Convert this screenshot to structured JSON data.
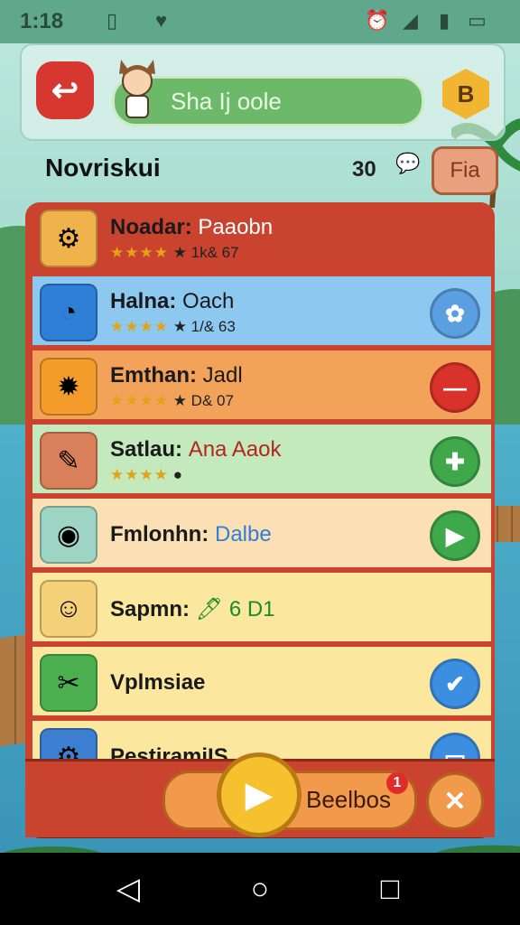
{
  "status_bar": {
    "time": "1:18"
  },
  "top_bar": {
    "player_name": "Sha Ij oole",
    "level_badge": "B"
  },
  "header": {
    "title": "Novriskui",
    "count": "30",
    "button_label": "Fia"
  },
  "rows": [
    {
      "title": "Noadar:",
      "subtitle": "Paaobn",
      "stars": "★★★★",
      "meta": "★ 1k& 67",
      "bg": "#c9432f",
      "title_color": "#1a1a1a",
      "sub_color": "#ffffff",
      "thumb_bg": "#f0b24a",
      "thumb_icon": "⚙",
      "action_bg": ""
    },
    {
      "title": "Halna:",
      "subtitle": "Oach",
      "stars": "★★★★",
      "meta": "★ 1/& 63",
      "bg": "#8cc8f0",
      "title_color": "#1a1a1a",
      "sub_color": "#1a1a1a",
      "thumb_bg": "#2f7fd6",
      "thumb_icon": "◔",
      "action_bg": "#5a9fe0",
      "action_icon": "✿"
    },
    {
      "title": "Emthan:",
      "subtitle": "Jadl",
      "stars": "★★★★",
      "meta": "★ D& 07",
      "bg": "#f3a25a",
      "title_color": "#1a1a1a",
      "sub_color": "#1a1a1a",
      "thumb_bg": "#f39c2b",
      "thumb_icon": "✹",
      "action_bg": "#d9322b",
      "action_icon": "—"
    },
    {
      "title": "Satlau:",
      "subtitle": "Ana Aaok",
      "stars": "★★★★",
      "meta": "●",
      "bg": "#c4e9bd",
      "title_color": "#1a1a1a",
      "sub_color": "#b1271f",
      "thumb_bg": "#d9805a",
      "thumb_icon": "✎",
      "action_bg": "#3fa84a",
      "action_icon": "✚"
    },
    {
      "title": "Fmlonhn:",
      "subtitle": "Dalbe",
      "stars": "",
      "meta": "",
      "bg": "#fbe0b6",
      "title_color": "#1a1a1a",
      "sub_color": "#2f7fd6",
      "thumb_bg": "#9ed4c4",
      "thumb_icon": "◉",
      "action_bg": "#3fa84a",
      "action_icon": "▶"
    },
    {
      "title": "Sapmn:",
      "subtitle": "🖊 6 D1",
      "stars": "",
      "meta": "",
      "bg": "#fbe79e",
      "title_color": "#1a1a1a",
      "sub_color": "#1b8a2a",
      "thumb_bg": "#f5d27a",
      "thumb_icon": "☺",
      "action_bg": ""
    },
    {
      "title": "Vplmsiae",
      "subtitle": "",
      "stars": "",
      "meta": "",
      "bg": "#fbe79e",
      "title_color": "#1a1a1a",
      "sub_color": "#1a1a1a",
      "thumb_bg": "#4caf50",
      "thumb_icon": "✂",
      "action_bg": "#3c8fe0",
      "action_icon": "✔"
    },
    {
      "title": "PestiramiIS",
      "subtitle": "",
      "stars": "",
      "meta": "",
      "bg": "#fbe79e",
      "title_color": "#1a1a1a",
      "sub_color": "#1a1a1a",
      "thumb_bg": "#3c7fd0",
      "thumb_icon": "⚙",
      "action_bg": "#3c8fe0",
      "action_icon": "▭"
    }
  ],
  "bottom_bar": {
    "label": "Beelbos",
    "notification_count": "1"
  }
}
